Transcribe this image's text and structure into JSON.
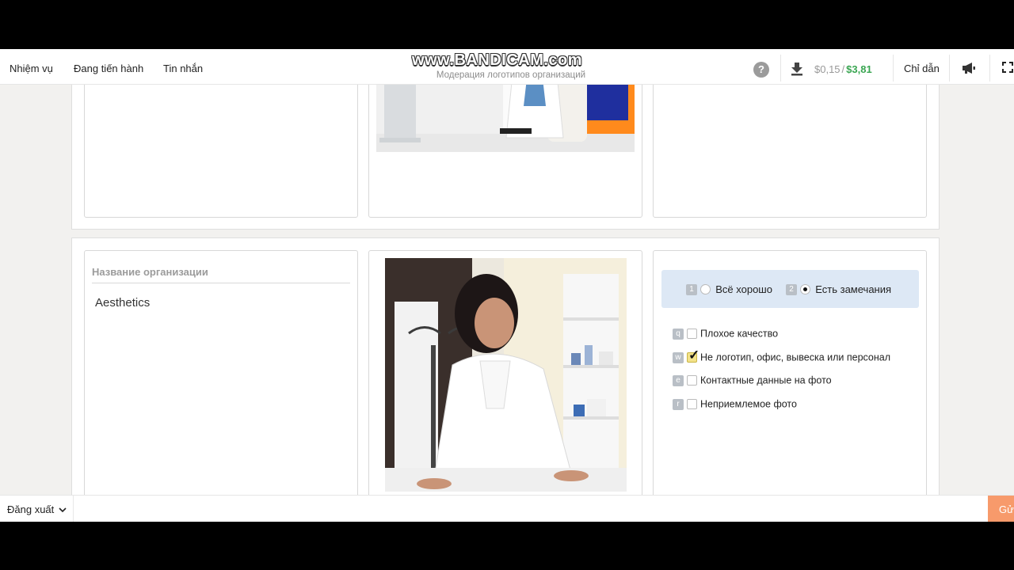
{
  "nav": {
    "tasks": "Nhiệm vụ",
    "in_progress": "Đang tiến hành",
    "messages": "Tin nhắn"
  },
  "watermark": "www.BANDICAM.com",
  "page_subtitle": "Модерация логотипов организаций",
  "header": {
    "help_icon": "question-circle-icon",
    "download_icon": "download-icon",
    "earned_current": "$0,15",
    "separator": "/",
    "earned_total": "$3,81",
    "guide": "Chỉ dẫn",
    "announce_icon": "megaphone-icon",
    "fullscreen_icon": "fullscreen-icon"
  },
  "task": {
    "field_label": "Название организации",
    "org_name": "Aesthetics",
    "radio": [
      {
        "key": "1",
        "label": "Всё хорошо",
        "selected": false
      },
      {
        "key": "2",
        "label": "Есть замечания",
        "selected": true
      }
    ],
    "checks": [
      {
        "key": "q",
        "label": "Плохое качество",
        "checked": false
      },
      {
        "key": "w",
        "label": "Не логотип, офис, вывеска или персонал",
        "checked": true
      },
      {
        "key": "e",
        "label": "Контактные данные на фото",
        "checked": false
      },
      {
        "key": "r",
        "label": "Неприемлемое фото",
        "checked": false
      }
    ]
  },
  "footer": {
    "logout": "Đăng xuất",
    "submit": "Gửi"
  },
  "colors": {
    "accent_green": "#3aa652",
    "submit_orange": "#f79a6b",
    "panel_blue": "#dde8f5"
  }
}
